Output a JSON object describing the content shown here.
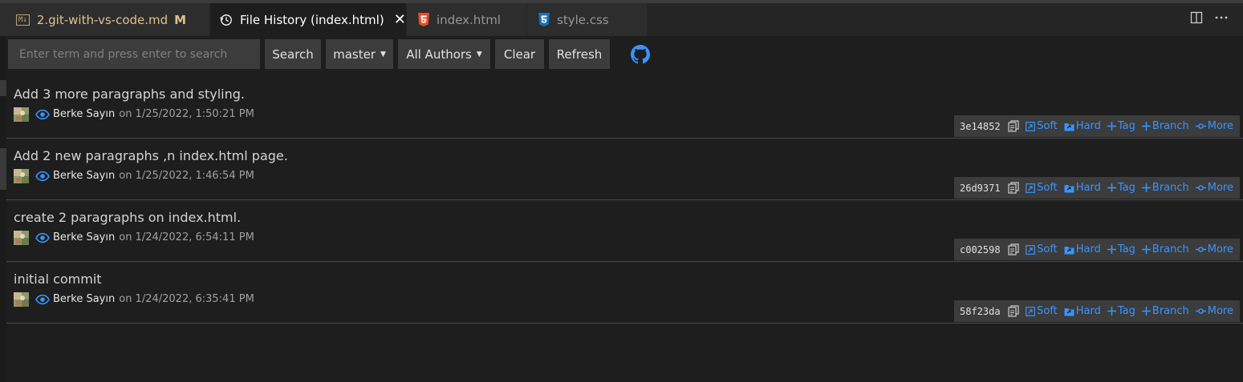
{
  "tabs": [
    {
      "badge": "M↓",
      "label": "2.git-with-vs-code.md",
      "status": "M"
    },
    {
      "label": "File History (index.html)",
      "close": "✕"
    },
    {
      "label": "index.html"
    },
    {
      "label": "style.css"
    }
  ],
  "toolbar": {
    "search_placeholder": "Enter term and press enter to search",
    "search_label": "Search",
    "branch_label": "master",
    "authors_label": "All Authors",
    "clear_label": "Clear",
    "refresh_label": "Refresh"
  },
  "actions": {
    "soft": "Soft",
    "hard": "Hard",
    "tag": "Tag",
    "branch": "Branch",
    "more": "More"
  },
  "commits": [
    {
      "message": "Add 3 more paragraphs and styling.",
      "author": "Berke Sayın",
      "date": "on 1/25/2022, 1:50:21 PM",
      "hash": "3e14852"
    },
    {
      "message": "Add 2 new paragraphs ,n index.html page.",
      "author": "Berke Sayın",
      "date": "on 1/25/2022, 1:46:54 PM",
      "hash": "26d9371"
    },
    {
      "message": "create 2 paragraphs on index.html.",
      "author": "Berke Sayın",
      "date": "on 1/24/2022, 6:54:11 PM",
      "hash": "c002598"
    },
    {
      "message": "initial commit",
      "author": "Berke Sayın",
      "date": "on 1/24/2022, 6:35:41 PM",
      "hash": "58f23da"
    }
  ],
  "colors": {
    "accent": "#3794ff",
    "modified": "#e2c08d",
    "html": "#e44d26",
    "css": "#1572b6"
  },
  "icons": [
    "history-icon",
    "html5-icon",
    "css3-icon",
    "split-editor-icon",
    "more-icon",
    "github-icon",
    "eye-icon",
    "copy-icon",
    "soft-reset-icon",
    "hard-reset-icon",
    "plus-icon",
    "more-commit-icon"
  ]
}
